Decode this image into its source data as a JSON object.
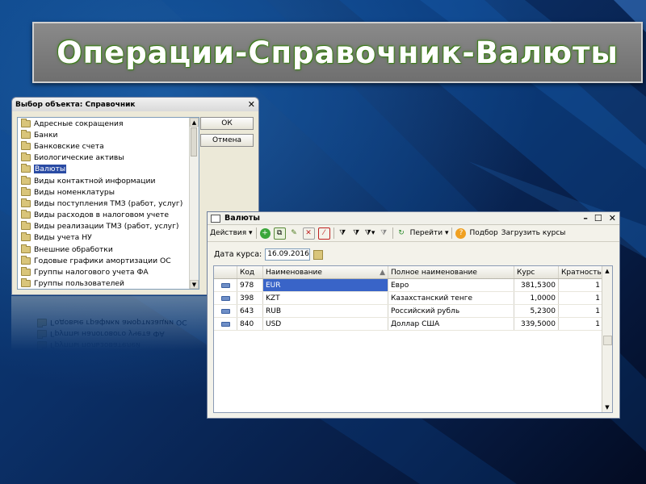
{
  "slide": {
    "title": "Операции-Справочник-Валюты"
  },
  "selector_dialog": {
    "title": "Выбор объекта: Справочник",
    "ok_label": "ОК",
    "cancel_label": "Отмена",
    "selected_index": 4,
    "items": [
      "Адресные сокращения",
      "Банки",
      "Банковские счета",
      "Биологические активы",
      "Валюты",
      "Виды контактной информации",
      "Виды номенклатуры",
      "Виды поступления ТМЗ (работ, услуг)",
      "Виды расходов в налоговом учете",
      "Виды реализации ТМЗ (работ, услуг)",
      "Виды учета НУ",
      "Внешние обработки",
      "Годовые графики амортизации ОС",
      "Группы налогового учета ФА",
      "Группы пользователей"
    ],
    "reflection_items": [
      "Группы пользователей",
      "Группы налогового учета ФА",
      "Годовые графики амортизации ОС"
    ]
  },
  "currencies_window": {
    "title": "Валюты",
    "toolbar": {
      "actions_label": "Действия",
      "goto_label": "Перейти",
      "selection_label": "Подбор",
      "load_rates_label": "Загрузить курсы"
    },
    "date_label": "Дата курса:",
    "date_value": "16.09.2016",
    "columns": [
      "Код",
      "Наименование",
      "Полное наименование",
      "Курс",
      "Кратность"
    ],
    "rows": [
      {
        "code": "978",
        "name": "EUR",
        "full_name": "Евро",
        "rate": "381,5300",
        "multiplicity": "1"
      },
      {
        "code": "398",
        "name": "KZT",
        "full_name": "Казахстанский тенге",
        "rate": "1,0000",
        "multiplicity": "1"
      },
      {
        "code": "643",
        "name": "RUB",
        "full_name": "Российский рубль",
        "rate": "5,2300",
        "multiplicity": "1"
      },
      {
        "code": "840",
        "name": "USD",
        "full_name": "Доллар США",
        "rate": "339,5000",
        "multiplicity": "1"
      }
    ],
    "selected_row": 0
  }
}
